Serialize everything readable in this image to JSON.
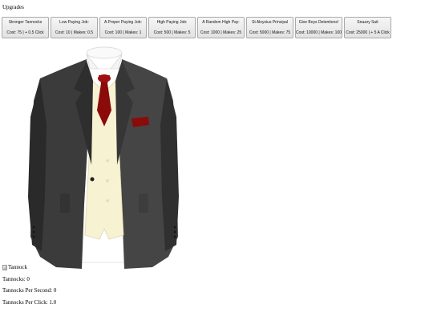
{
  "heading": "Upgrades",
  "upgrades": [
    {
      "name": "Stronger Tannocks",
      "stats": "Cost: 75 | + 0.5 Click"
    },
    {
      "name": "Low Paying Job:",
      "stats": "Cost: 10 | Makes: 0.5"
    },
    {
      "name": "A Proper Paying Job:",
      "stats": "Cost: 100 | Makes: 1"
    },
    {
      "name": "High Paying Job:",
      "stats": "Cost: 500 | Makes: 5"
    },
    {
      "name": "A Random High Pay:",
      "stats": "Cost: 1000 | Makes: 25"
    },
    {
      "name": "St Aloysius Principal",
      "stats": "Cost: 5000 | Makes: 75"
    },
    {
      "name": "Give Boys Detentions!",
      "stats": "Cost: 10000 | Makes: 100"
    },
    {
      "name": "Snazzy Suit",
      "stats": "Cost: 25000 | + 5 A Click"
    }
  ],
  "image_alt": "Tannock",
  "stats": {
    "tannocks": "Tannocks: 0",
    "per_second": "Tannocks Per Second: 0",
    "per_click": "Tannocks Per Click: 1.0"
  }
}
